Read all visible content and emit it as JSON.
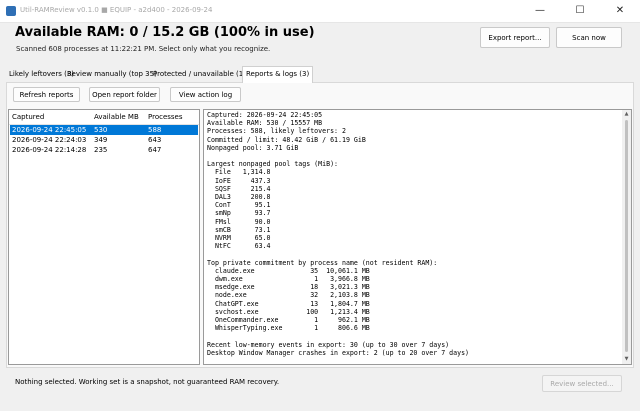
{
  "window": {
    "title": "Util-RAMReview v0.1.0  ■ EQUIP - a2d400 - 2026-09-24",
    "controls": {
      "minimize": "—",
      "maximize": "☐",
      "close": "✕"
    }
  },
  "header": {
    "title": "Available RAM: 0 / 15.2 GB    (100% in use)",
    "subtitle": "Scanned 608 processes at 11:22:21 PM. Select only what you recognize.",
    "export_label": "Export report...",
    "scan_label": "Scan now"
  },
  "tabs": [
    {
      "label": "Likely leftovers (3)"
    },
    {
      "label": "Review manually (top 35)"
    },
    {
      "label": "Protected / unavailable (13)"
    },
    {
      "label": "Reports & logs (3)",
      "active": true
    }
  ],
  "toolbar": {
    "refresh_label": "Refresh reports",
    "open_folder_label": "Open report folder",
    "action_log_label": "View action log"
  },
  "reports_list": {
    "columns": [
      "Captured",
      "Available MB",
      "Processes"
    ],
    "rows": [
      {
        "captured": "2026-09-24 22:45:05",
        "available_mb": "530",
        "processes": "588",
        "selected": true
      },
      {
        "captured": "2026-09-24 22:24:03",
        "available_mb": "349",
        "processes": "643"
      },
      {
        "captured": "2026-09-24 22:14:28",
        "available_mb": "235",
        "processes": "647"
      }
    ]
  },
  "report_text": "Captured: 2026-09-24 22:45:05\nAvailable RAM: 530 / 15557 MB\nProcesses: 588, likely leftovers: 2\nCommitted / limit: 48.42 GiB / 61.19 GiB\nNonpaged pool: 3.71 GiB\n\nLargest nonpaged pool tags (MiB):\n  File   1,314.8\n  IoFE     437.3\n  SQSF     215.4\n  DAL3     200.8\n  ConT      95.1\n  smNp      93.7\n  FMsl      90.0\n  smCB      73.1\n  NVRM      65.0\n  NtFC      63.4\n\nTop private commitment by process name (not resident RAM):\n  claude.exe              35  10,061.1 MB\n  dwm.exe                  1   3,966.8 MB\n  msedge.exe              18   3,021.3 MB\n  node.exe                32   2,103.8 MB\n  ChatGPT.exe             13   1,804.7 MB\n  svchost.exe            100   1,213.4 MB\n  OneCommander.exe         1     962.1 MB\n  WhisperTyping.exe        1     806.6 MB\n\nRecent low-memory events in export: 30 (up to 30 over 7 days)\nDesktop Window Manager crashes in export: 2 (up to 20 over 7 days)",
  "status": {
    "text": "Nothing selected. Working set is a snapshot, not guaranteed RAM recovery.",
    "review_label": "Review selected..."
  },
  "colors": {
    "selection": "#0078d7",
    "background": "#f0f0f0"
  }
}
